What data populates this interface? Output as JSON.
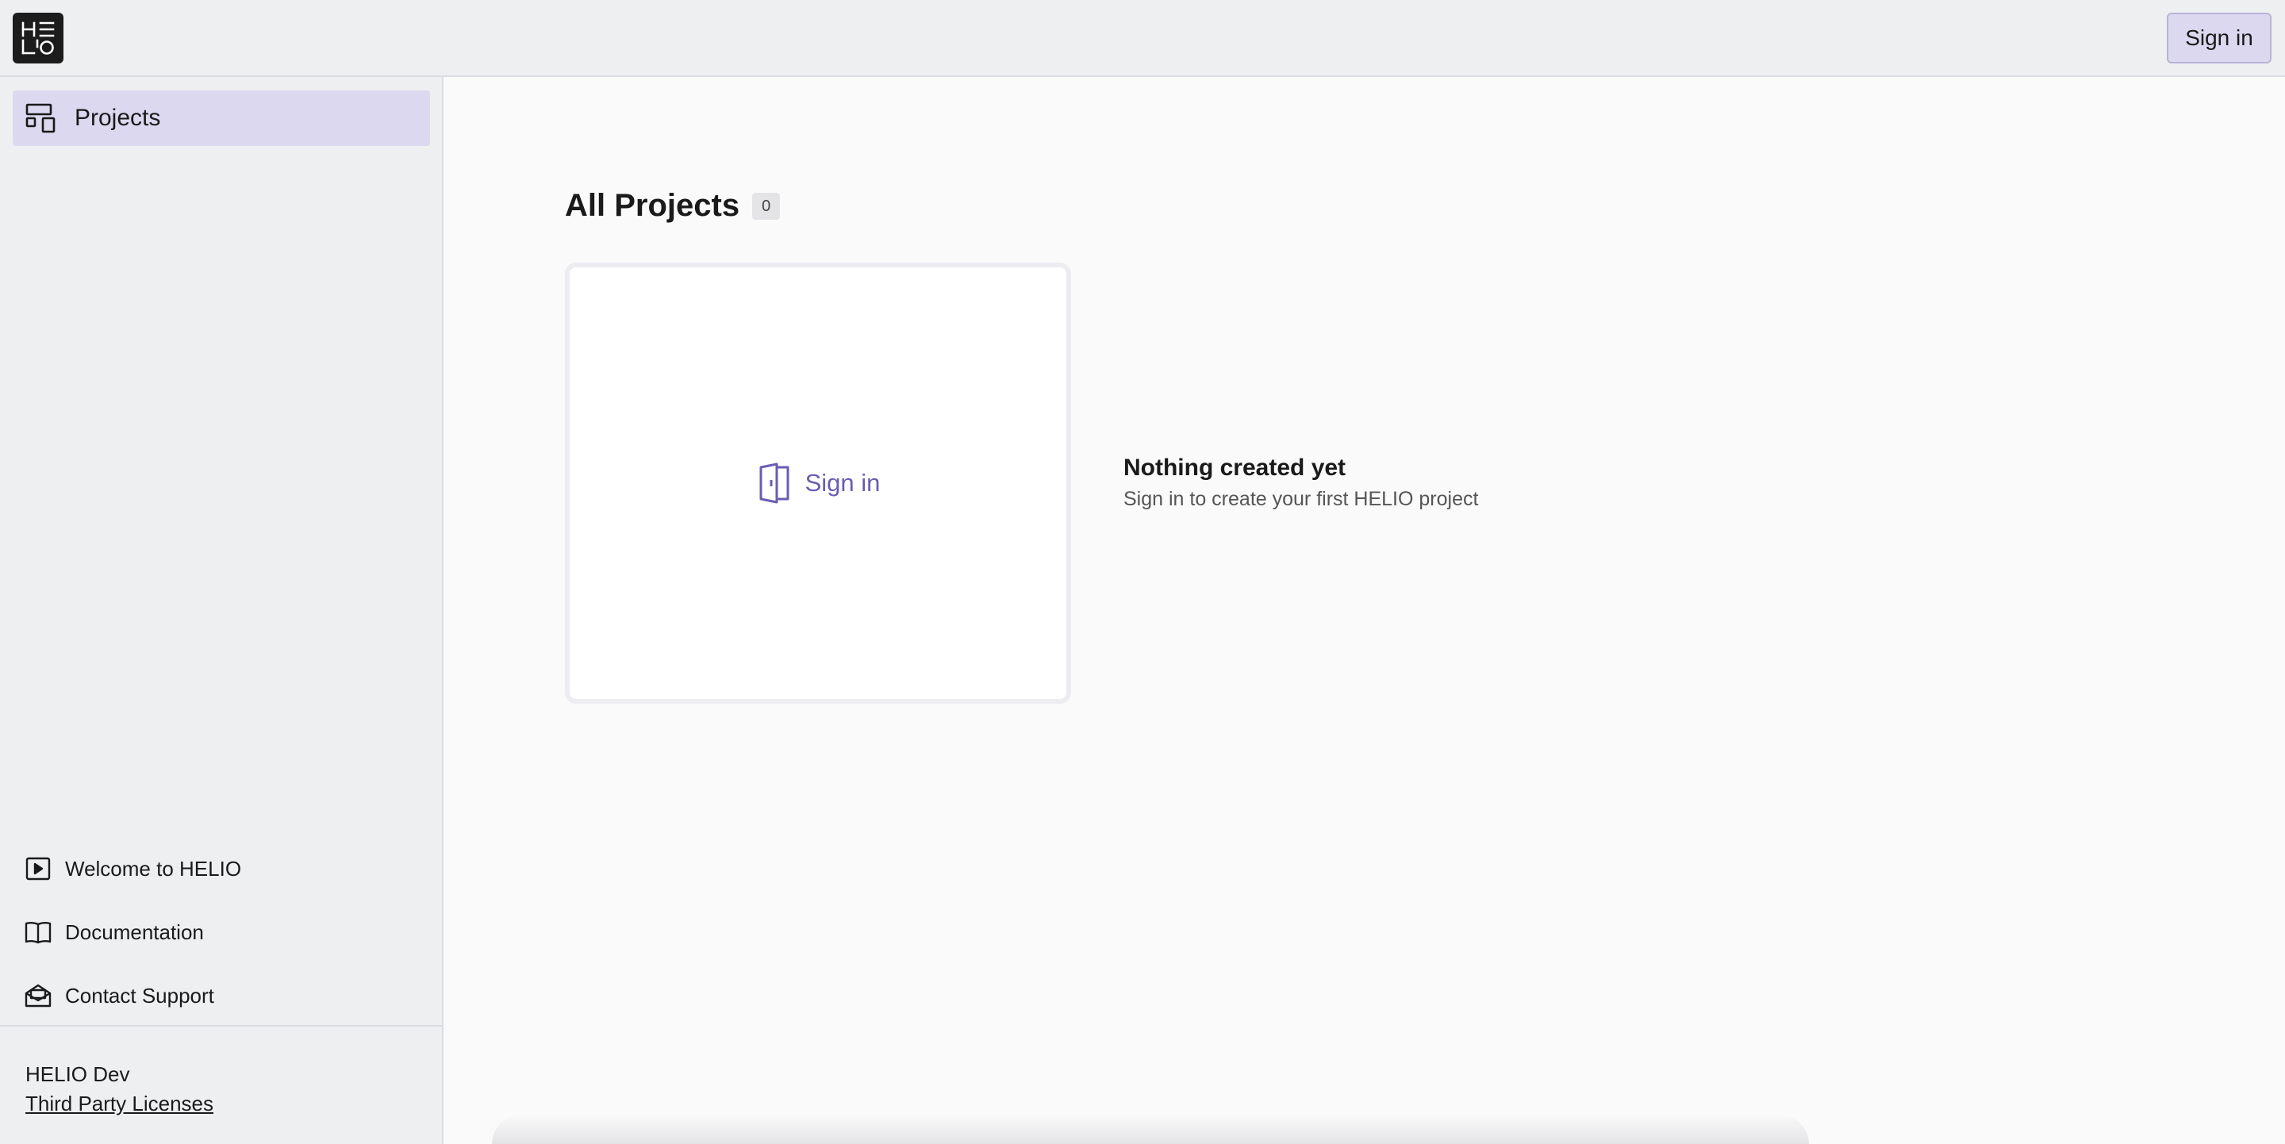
{
  "header": {
    "logo_alt": "HELIO",
    "sign_in_label": "Sign in"
  },
  "sidebar": {
    "nav": [
      {
        "label": "Projects",
        "icon": "projects-icon",
        "active": true
      }
    ],
    "links": [
      {
        "label": "Welcome to HELIO",
        "icon": "play-icon"
      },
      {
        "label": "Documentation",
        "icon": "book-icon"
      },
      {
        "label": "Contact Support",
        "icon": "mail-icon"
      }
    ],
    "footer": {
      "env_name": "HELIO Dev",
      "licenses_label": "Third Party Licenses"
    }
  },
  "main": {
    "heading": "All Projects",
    "count": "0",
    "card": {
      "label": "Sign in",
      "icon": "door-icon"
    },
    "empty_state": {
      "title": "Nothing created yet",
      "subtitle": "Sign in to create your first HELIO project"
    }
  },
  "colors": {
    "accent": "#6a5db0",
    "accent_bg": "#dcd8ef",
    "sidebar_bg": "#eeeff1",
    "main_bg": "#fafafa"
  }
}
